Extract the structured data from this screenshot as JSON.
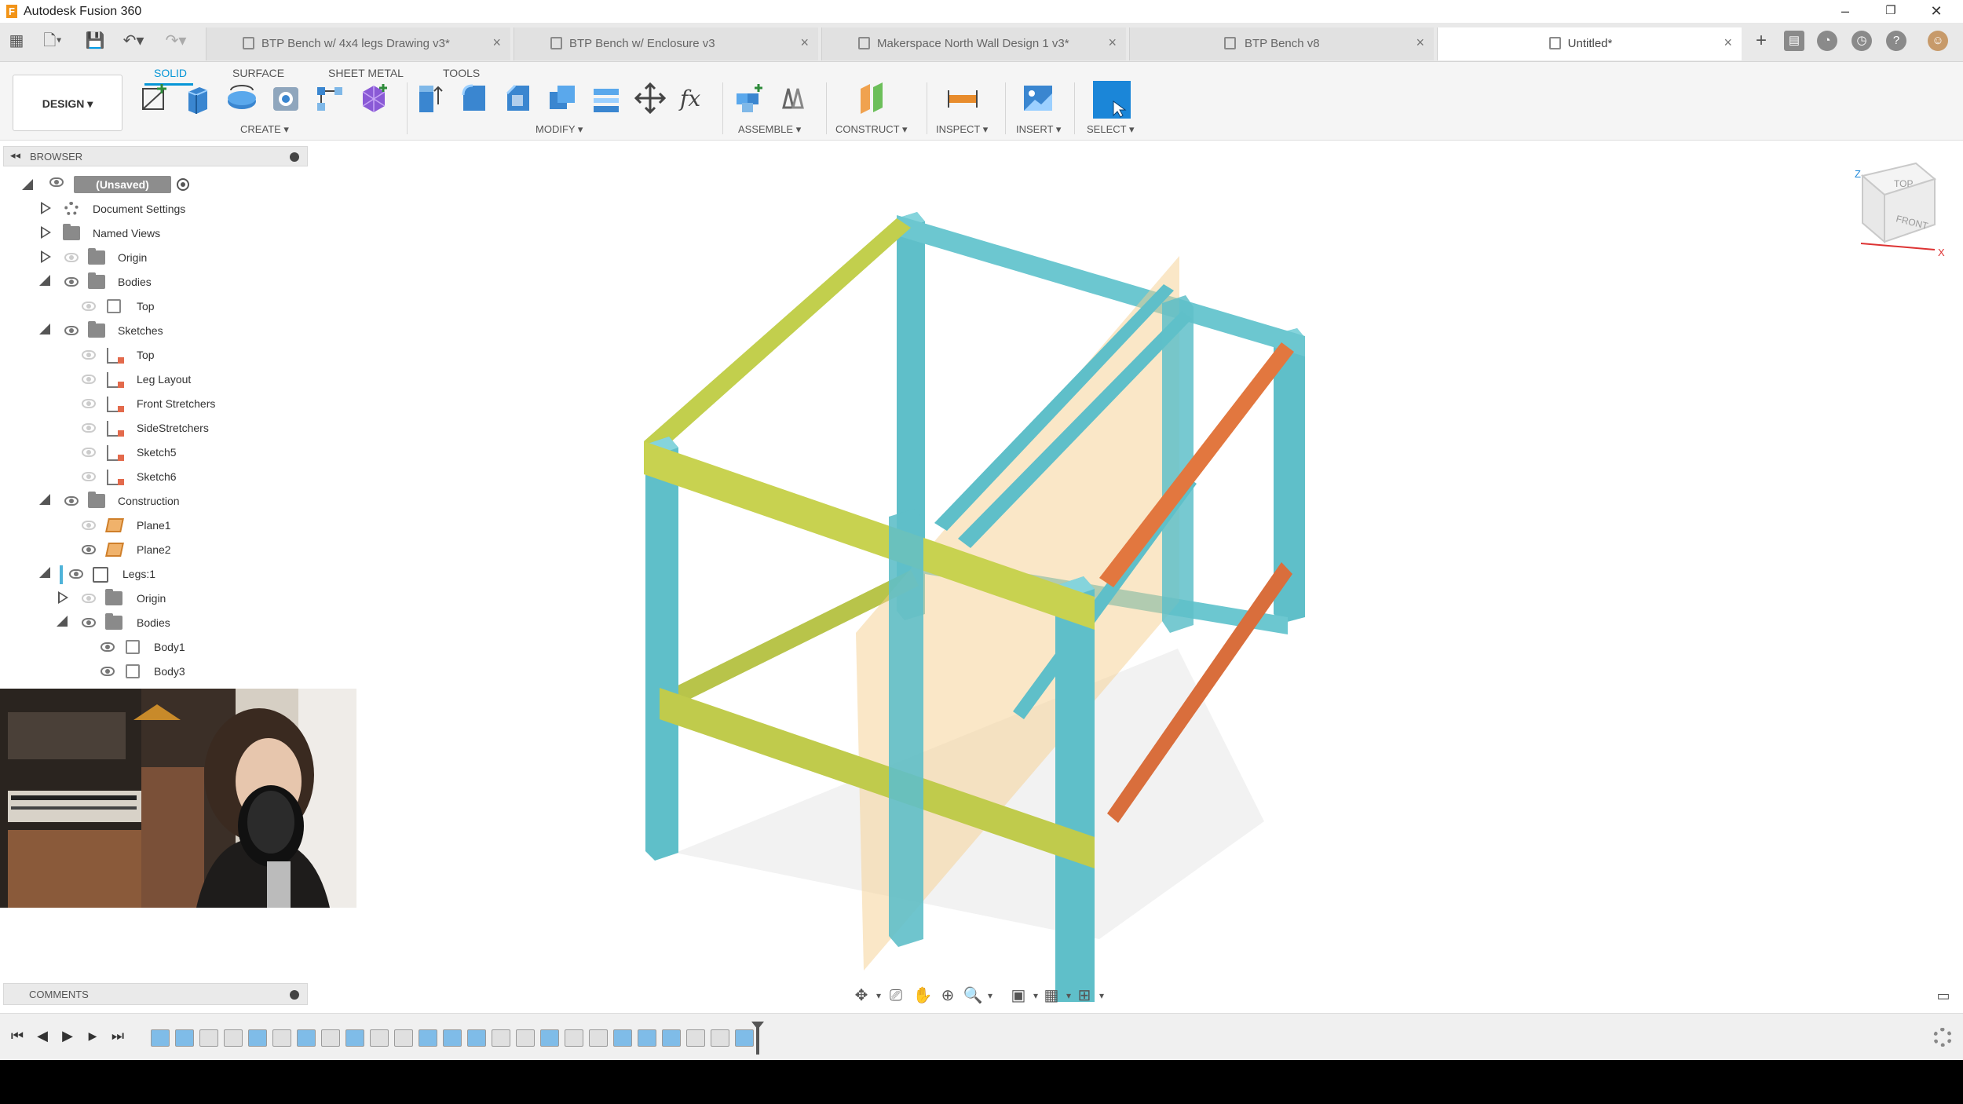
{
  "app": {
    "title": "Autodesk Fusion 360",
    "logo_letter": "F",
    "window_controls": [
      "minimize-icon",
      "restore-icon",
      "close-icon"
    ]
  },
  "tabs": [
    {
      "label": "BTP Bench w/ 4x4 legs Drawing v3*",
      "close": "×",
      "active": false
    },
    {
      "label": "BTP Bench w/ Enclosure v3",
      "close": "×",
      "active": false
    },
    {
      "label": "Makerspace North Wall Design 1 v3*",
      "close": "×",
      "active": false
    },
    {
      "label": "BTP Bench v8",
      "close": "×",
      "active": false
    },
    {
      "label": "Untitled*",
      "close": "×",
      "active": true
    }
  ],
  "header_icons": [
    "new-tab-icon",
    "job-status-icon",
    "notifications-icon",
    "extensions-icon",
    "help-icon",
    "user-avatar"
  ],
  "ribbon": {
    "workspace": "DESIGN ▾",
    "mode_tabs": [
      "SOLID",
      "SURFACE",
      "SHEET METAL",
      "TOOLS"
    ],
    "active_mode": "SOLID",
    "groups": [
      "CREATE ▾",
      "MODIFY ▾",
      "ASSEMBLE ▾",
      "CONSTRUCT ▾",
      "INSPECT ▾",
      "INSERT ▾",
      "SELECT ▾"
    ],
    "accent": "#0696d7"
  },
  "browser": {
    "title": "BROWSER",
    "root_label": "(Unsaved)",
    "items": [
      {
        "label": "Document Settings",
        "icon": "gear-icon"
      },
      {
        "label": "Named Views",
        "icon": "folder-icon"
      },
      {
        "label": "Origin",
        "icon": "folder-icon"
      },
      {
        "label": "Bodies",
        "icon": "folder-icon"
      },
      {
        "label": "Top",
        "icon": "body-icon"
      },
      {
        "label": "Sketches",
        "icon": "folder-icon"
      },
      {
        "label": "Top",
        "icon": "sketch-icon"
      },
      {
        "label": "Leg Layout",
        "icon": "sketch-icon"
      },
      {
        "label": "Front Stretchers",
        "icon": "sketch-icon"
      },
      {
        "label": "SideStretchers",
        "icon": "sketch-icon"
      },
      {
        "label": "Sketch5",
        "icon": "sketch-icon"
      },
      {
        "label": "Sketch6",
        "icon": "sketch-icon"
      },
      {
        "label": "Construction",
        "icon": "folder-icon"
      },
      {
        "label": "Plane1",
        "icon": "plane-icon"
      },
      {
        "label": "Plane2",
        "icon": "plane-icon"
      },
      {
        "label": "Legs:1",
        "icon": "component-icon"
      },
      {
        "label": "Origin",
        "icon": "folder-icon"
      },
      {
        "label": "Bodies",
        "icon": "folder-icon"
      },
      {
        "label": "Body1",
        "icon": "body-icon"
      },
      {
        "label": "Body3",
        "icon": "body-icon"
      }
    ]
  },
  "comments": {
    "title": "COMMENTS"
  },
  "viewcube": {
    "top": "TOP",
    "front": "FRONT",
    "axis_z": "Z",
    "axis_x": "X"
  },
  "model_colors": {
    "legs": "#5fbfc9",
    "front_rails": "#c2cf4d",
    "side_rails": "#e2773f",
    "plane": "#f6cf8f"
  },
  "timeline": {
    "controls": [
      "⏮",
      "◀",
      "▶",
      "▶",
      "⏭"
    ],
    "feature_colors": [
      "#7fbce8",
      "#7fbce8",
      "#e0e0e0",
      "#e0e0e0",
      "#7fbce8",
      "#e0e0e0",
      "#7fbce8",
      "#e0e0e0",
      "#7fbce8",
      "#e0e0e0",
      "#e0e0e0",
      "#7fbce8",
      "#7fbce8",
      "#7fbce8",
      "#e0e0e0",
      "#e0e0e0",
      "#7fbce8",
      "#e0e0e0",
      "#e0e0e0",
      "#7fbce8",
      "#7fbce8",
      "#7fbce8",
      "#e0e0e0",
      "#e0e0e0",
      "#7fbce8"
    ]
  }
}
